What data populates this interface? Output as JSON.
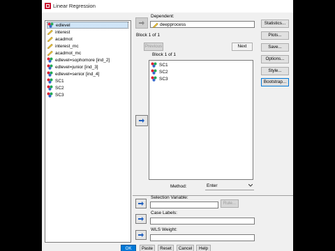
{
  "window": {
    "title": "Linear Regression"
  },
  "variables": [
    {
      "label": "edlevel",
      "icon": "nominal-icon",
      "selected": true
    },
    {
      "label": "interest",
      "icon": "scale-icon"
    },
    {
      "label": "acadmot",
      "icon": "scale-icon"
    },
    {
      "label": "interest_mc",
      "icon": "scale-icon"
    },
    {
      "label": "acadmot_mc",
      "icon": "scale-icon"
    },
    {
      "label": "edlevel=sophomore [ind_2]",
      "icon": "nominal-icon"
    },
    {
      "label": "edlevel=junior [ind_3]",
      "icon": "nominal-icon"
    },
    {
      "label": "edlevel=senior [ind_4]",
      "icon": "nominal-icon"
    },
    {
      "label": "SC1",
      "icon": "nominal-icon"
    },
    {
      "label": "SC2",
      "icon": "nominal-icon"
    },
    {
      "label": "SC3",
      "icon": "nominal-icon"
    }
  ],
  "dependent": {
    "label": "Dependent:",
    "value": "deepprocess"
  },
  "block": {
    "header": "Block 1 of 1",
    "inner_label": "Block 1 of 1",
    "previous": "Previous",
    "next": "Next",
    "items": [
      "SC1",
      "SC2",
      "SC3"
    ]
  },
  "method": {
    "label": "Method:",
    "value": "Enter"
  },
  "selection": {
    "label": "Selection Variable:",
    "rule": "Rule..."
  },
  "case_labels": {
    "label": "Case Labels:"
  },
  "wls": {
    "label": "WLS Weight:"
  },
  "side_buttons": [
    "Statistics...",
    "Plots...",
    "Save...",
    "Options...",
    "Style...",
    "Bootstrap..."
  ],
  "bottom_buttons": {
    "ok": "OK",
    "paste": "Paste",
    "reset": "Reset",
    "cancel": "Cancel",
    "help": "Help"
  },
  "colors": {
    "selection": "#cfe4f7",
    "accent": "#0078d7",
    "arrow": "#1f5fbf"
  }
}
